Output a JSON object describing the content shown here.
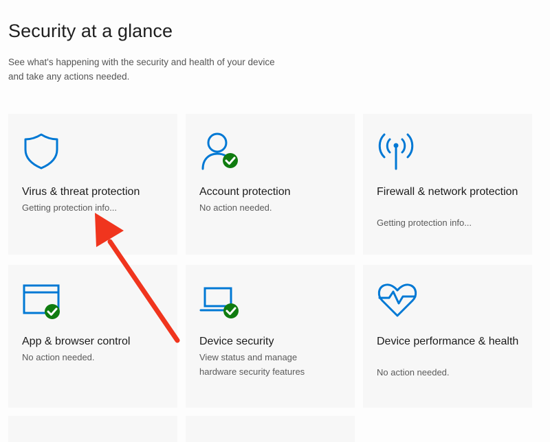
{
  "header": {
    "title": "Security at a glance",
    "subtitle": "See what's happening with the security and health of your device and take any actions needed."
  },
  "colors": {
    "icon_blue": "#0078d4",
    "status_green": "#107c10",
    "annotation_red": "#f0351e"
  },
  "tiles": [
    {
      "title": "Virus & threat protection",
      "status": "Getting protection info...",
      "icon": "shield-icon",
      "status_icon": "none"
    },
    {
      "title": "Account protection",
      "status": "No action needed.",
      "icon": "person-icon",
      "status_icon": "green-check-icon"
    },
    {
      "title": "Firewall & network protection",
      "status": "Getting protection info...",
      "icon": "wireless-antenna-icon",
      "status_icon": "none"
    },
    {
      "title": "App & browser control",
      "status": "No action needed.",
      "icon": "browser-window-icon",
      "status_icon": "green-check-icon"
    },
    {
      "title": "Device security",
      "status": "View status and manage hardware security features",
      "icon": "laptop-icon",
      "status_icon": "green-check-icon"
    },
    {
      "title": "Device performance & health",
      "status": "No action needed.",
      "icon": "heart-pulse-icon",
      "status_icon": "none"
    }
  ],
  "annotation": {
    "icon": "red-arrow-icon",
    "points_to": "tiles.0.status"
  }
}
